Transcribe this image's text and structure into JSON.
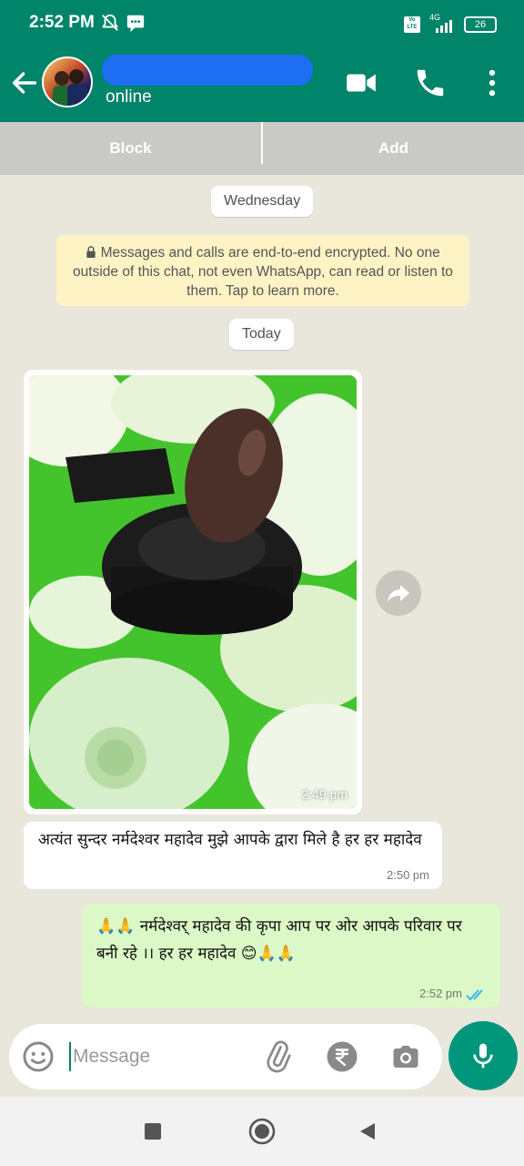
{
  "status_bar": {
    "time": "2:52 PM",
    "network": "4G",
    "volte": "Vo LTE",
    "battery": "26",
    "icons": [
      "mute-icon",
      "message-notification-icon",
      "signal-icon"
    ]
  },
  "header": {
    "contact_status": "online",
    "icons": [
      "back-arrow-icon",
      "video-call-icon",
      "voice-call-icon",
      "more-options-icon"
    ]
  },
  "action_bar": {
    "block_label": "Block",
    "add_label": "Add"
  },
  "chat": {
    "day_separator_1": "Wednesday",
    "encryption_notice": "Messages and calls are end-to-end encrypted. No one outside of this chat, not even WhatsApp, can read or listen to them. Tap to learn more.",
    "day_separator_2": "Today",
    "messages": [
      {
        "type": "image",
        "direction": "incoming",
        "time": "2:49 pm"
      },
      {
        "type": "text",
        "direction": "incoming",
        "text": "अत्यंत सुन्दर नर्मदेश्वर महादेव मुझे आपके द्वारा मिले है हर हर महादेव",
        "time": "2:50 pm"
      },
      {
        "type": "text",
        "direction": "outgoing",
        "text": "🙏🙏 नर्मदेश्वर् महादेव की कृपा आप पर ओर आपके परिवार पर बनी रहे ।। हर हर महादेव 😊🙏🙏",
        "time": "2:52 pm",
        "status": "read"
      }
    ]
  },
  "input": {
    "placeholder": "Message",
    "icons": [
      "emoji-icon",
      "attach-icon",
      "rupee-payment-icon",
      "camera-icon",
      "mic-icon"
    ]
  },
  "colors": {
    "brand": "#00846a",
    "outgoing_bubble": "#dcf8c6",
    "read_ticks": "#34b7f1"
  }
}
